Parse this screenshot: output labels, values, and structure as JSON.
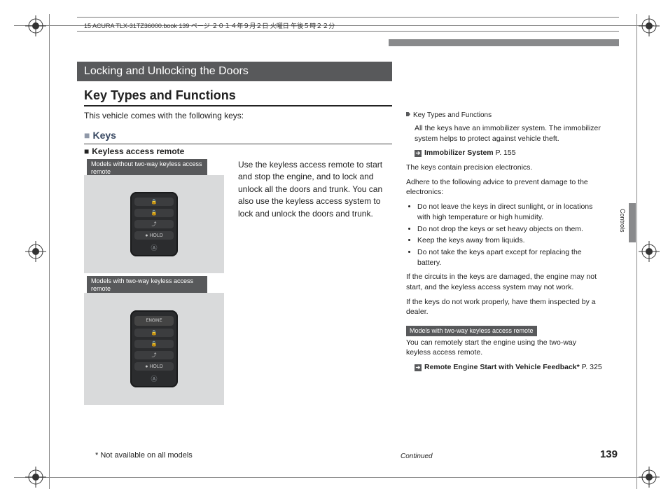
{
  "meta": {
    "header": "15 ACURA TLX-31TZ36000.book  139 ページ  ２０１４年９月２日  火曜日  午後５時２２分"
  },
  "page": {
    "chapter": "Locking and Unlocking the Doors",
    "h1": "Key Types and Functions",
    "intro": "This vehicle comes with the following keys:",
    "h2": "Keys",
    "h3": "Keyless access remote",
    "label_no_twoway": "Models without two-way keyless access remote",
    "label_twoway": "Models with two-way keyless access remote",
    "main_body": "Use the keyless access remote to start and stop the engine, and to lock and unlock all the doors and trunk. You can also use the keyless access system to lock and unlock the doors and trunk.",
    "footnote": "* Not available on all models",
    "continued": "Continued",
    "number": "139",
    "tab": "Controls"
  },
  "side": {
    "head": "Key Types and Functions",
    "p1": "All the keys have an immobilizer system. The immobilizer system helps to protect against vehicle theft.",
    "ref1_label": "Immobilizer System",
    "ref1_page": "P. 155",
    "p2a": "The keys contain precision electronics.",
    "p2b": "Adhere to the following advice to prevent damage to the electronics:",
    "bullets": [
      "Do not leave the keys in direct sunlight, or in locations with high temperature or high humidity.",
      "Do not drop the keys or set heavy objects on them.",
      "Keep the keys away from liquids.",
      "Do not take the keys apart except for replacing the battery."
    ],
    "p3": "If the circuits in the keys are damaged, the engine may not start, and the keyless access system may not work.",
    "p4": "If the keys do not work properly, have them inspected by a dealer.",
    "label_twoway": "Models with two-way keyless access remote",
    "p5": "You can remotely start the engine using the two-way keyless access remote.",
    "ref2_label": "Remote Engine Start with Vehicle Feedback*",
    "ref2_page": "P. 325"
  },
  "fob": {
    "btn_engine": "ENGINE",
    "btn_lock": "🔒",
    "btn_unlock": "🔓",
    "btn_trunk": "⤴",
    "btn_hold": "● HOLD",
    "logo": "Ⓐ"
  }
}
